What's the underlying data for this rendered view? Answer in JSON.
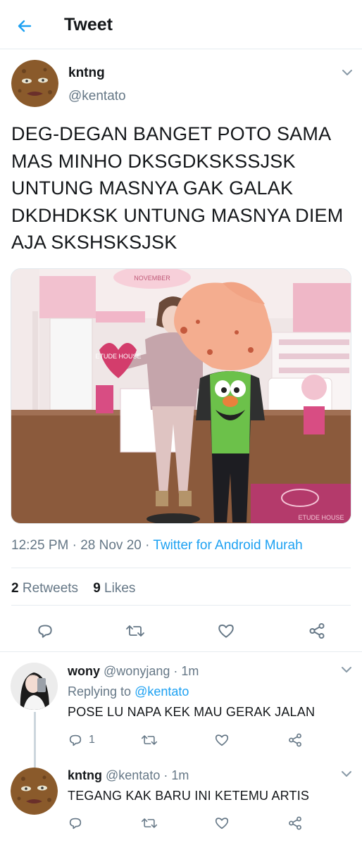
{
  "header": {
    "title": "Tweet"
  },
  "tweet": {
    "display_name": "kntng",
    "handle": "@kentato",
    "text": "DEG-DEGAN BANGET POTO SAMA MAS MINHO DKSGDKSKSSJSK UNTUNG MASNYA GAK GALAK DKDHDKSK UNTUNG MASNYA DIEM AJA SKSHSKSJSK",
    "time": "12:25 PM",
    "date": "28 Nov 20",
    "separator": " · ",
    "source": "Twitter for Android Murah",
    "retweets_count": "2",
    "retweets_label": " Retweets",
    "likes_count": "9",
    "likes_label": " Likes",
    "media_sign_text": "NOVEMBER",
    "media_heart_text": "ETUDE HOUSE",
    "media_mat_text": "ETUDE HOUSE"
  },
  "replies": [
    {
      "display_name": "wony",
      "handle": "@wonyjang",
      "age": "1m",
      "replying_label": "Replying to ",
      "replying_to": "@kentato",
      "text": "POSE LU NAPA KEK MAU GERAK JALAN",
      "reply_count": "1"
    },
    {
      "display_name": "kntng",
      "handle": "@kentato",
      "age": "1m",
      "text": "TEGANG KAK BARU INI KETEMU ARTIS"
    }
  ],
  "colors": {
    "accent": "#1da1f2",
    "secondary_text": "#657786",
    "primary_text": "#14171a",
    "divider": "#e6ecf0"
  },
  "icons": {
    "back": "arrow-left-icon",
    "caret": "chevron-down-icon",
    "reply": "comment-icon",
    "retweet": "retweet-icon",
    "like": "heart-icon",
    "share": "share-icon"
  }
}
